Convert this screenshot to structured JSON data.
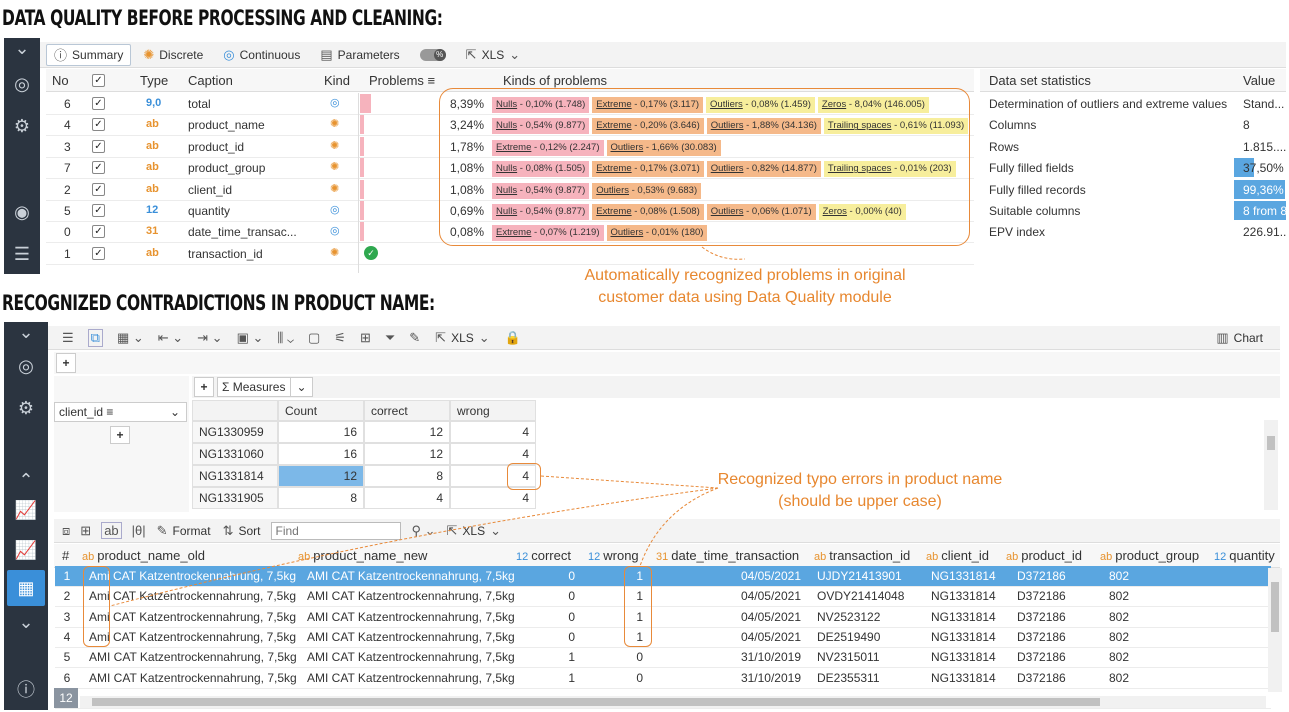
{
  "headings": {
    "top": "DATA QUALITY BEFORE PROCESSING AND CLEANING:",
    "bottom": "RECOGNIZED CONTRADICTIONS IN PRODUCT NAME:"
  },
  "dq_toolbar": {
    "summary": "Summary",
    "discrete": "Discrete",
    "continuous": "Continuous",
    "parameters": "Parameters",
    "xls": "XLS"
  },
  "dq_table": {
    "headers": {
      "no": "No",
      "type": "Type",
      "caption": "Caption",
      "kind": "Kind",
      "problems": "Problems",
      "kinds": "Kinds of problems"
    },
    "rows": [
      {
        "no": "6",
        "type": "9,0",
        "caption": "total",
        "kind": "continuous",
        "pct": "8,39%",
        "bar": 0.9,
        "tags": [
          {
            "c": "red",
            "name": "Nulls",
            "rest": " - 0,10% (1.748)"
          },
          {
            "c": "org",
            "name": "Extreme",
            "rest": " - 0,17% (3.117)"
          },
          {
            "c": "yel",
            "name": "Outliers",
            "rest": " - 0,08% (1.459)"
          },
          {
            "c": "yel",
            "name": "Zeros",
            "rest": " - 8,04% (146.005)"
          }
        ]
      },
      {
        "no": "4",
        "type": "ab",
        "caption": "product_name",
        "kind": "discrete",
        "pct": "3,24%",
        "bar": 0.35,
        "tags": [
          {
            "c": "red",
            "name": "Nulls",
            "rest": " - 0,54% (9.877)"
          },
          {
            "c": "org",
            "name": "Extreme",
            "rest": " - 0,20% (3.646)"
          },
          {
            "c": "org",
            "name": "Outliers",
            "rest": " - 1,88% (34.136)"
          },
          {
            "c": "yel",
            "name": "Trailing spaces",
            "rest": " - 0,61% (11.093)"
          }
        ]
      },
      {
        "no": "3",
        "type": "ab",
        "caption": "product_id",
        "kind": "discrete",
        "pct": "1,78%",
        "bar": 0.2,
        "tags": [
          {
            "c": "red",
            "name": "Extreme",
            "rest": " - 0,12% (2.247)"
          },
          {
            "c": "org",
            "name": "Outliers",
            "rest": " - 1,66% (30.083)"
          }
        ]
      },
      {
        "no": "7",
        "type": "ab",
        "caption": "product_group",
        "kind": "discrete",
        "pct": "1,08%",
        "bar": 0.12,
        "tags": [
          {
            "c": "red",
            "name": "Nulls",
            "rest": " - 0,08% (1.505)"
          },
          {
            "c": "org",
            "name": "Extreme",
            "rest": " - 0,17% (3.071)"
          },
          {
            "c": "org",
            "name": "Outliers",
            "rest": " - 0,82% (14.877)"
          },
          {
            "c": "yel",
            "name": "Trailing spaces",
            "rest": " - 0,01% (203)"
          }
        ]
      },
      {
        "no": "2",
        "type": "ab",
        "caption": "client_id",
        "kind": "discrete",
        "pct": "1,08%",
        "bar": 0.12,
        "tags": [
          {
            "c": "red",
            "name": "Nulls",
            "rest": " - 0,54% (9.877)"
          },
          {
            "c": "org",
            "name": "Outliers",
            "rest": " - 0,53% (9.683)"
          }
        ]
      },
      {
        "no": "5",
        "type": "12",
        "caption": "quantity",
        "kind": "continuous",
        "pct": "0,69%",
        "bar": 0.08,
        "tags": [
          {
            "c": "red",
            "name": "Nulls",
            "rest": " - 0,54% (9.877)"
          },
          {
            "c": "org",
            "name": "Extreme",
            "rest": " - 0,08% (1.508)"
          },
          {
            "c": "org",
            "name": "Outliers",
            "rest": " - 0,06% (1.071)"
          },
          {
            "c": "yel",
            "name": "Zeros",
            "rest": " - 0,00% (40)"
          }
        ]
      },
      {
        "no": "0",
        "type": "31",
        "caption": "date_time_transac...",
        "kind": "continuous",
        "pct": "0,08%",
        "bar": 0.02,
        "tags": [
          {
            "c": "red",
            "name": "Extreme",
            "rest": " - 0,07% (1.219)"
          },
          {
            "c": "org",
            "name": "Outliers",
            "rest": " - 0,01% (180)"
          }
        ]
      },
      {
        "no": "1",
        "type": "ab",
        "caption": "transaction_id",
        "kind": "discrete",
        "pct": "",
        "bar": 0,
        "ok": true,
        "tags": []
      }
    ]
  },
  "stats": {
    "headers": {
      "name": "Data set statistics",
      "value": "Value"
    },
    "rows": [
      {
        "name": "Determination of outliers and extreme values",
        "value": "Stand...",
        "bar": 0
      },
      {
        "name": "Columns",
        "value": "8",
        "bar": 0
      },
      {
        "name": "Rows",
        "value": "1.815....",
        "bar": 0
      },
      {
        "name": "Fully filled fields",
        "value": "37,50%",
        "bar": 0.375
      },
      {
        "name": "Fully filled records",
        "value": "99,36%",
        "bar": 0.99
      },
      {
        "name": "Suitable columns",
        "value": "8 from 8",
        "bar": 1
      },
      {
        "name": "EPV index",
        "value": "226.91...",
        "bar": 0
      }
    ]
  },
  "annotations": {
    "top": "Automatically recognized problems in original customer data using Data Quality module",
    "bottom": "Recognized typo errors in product name (should be upper case)"
  },
  "pivot_toolbar": {
    "xls": "XLS",
    "chart": "Chart"
  },
  "pivot": {
    "measures": "Measures",
    "field": "client_id",
    "headers": [
      "Count",
      "correct",
      "wrong"
    ],
    "rows": [
      {
        "id": "NG1330959",
        "count": "16",
        "correct": "12",
        "wrong": "4"
      },
      {
        "id": "NG1331060",
        "count": "16",
        "correct": "12",
        "wrong": "4"
      },
      {
        "id": "NG1331814",
        "count": "12",
        "correct": "8",
        "wrong": "4"
      },
      {
        "id": "NG1331905",
        "count": "8",
        "correct": "4",
        "wrong": "4"
      }
    ]
  },
  "data_toolbar": {
    "format": "Format",
    "sort": "Sort",
    "search_placeholder": "Find",
    "xls": "XLS"
  },
  "data_table": {
    "headers": [
      "#",
      "product_name_old",
      "product_name_new",
      "correct",
      "wrong",
      "date_time_transaction",
      "transaction_id",
      "client_id",
      "product_id",
      "product_group",
      "quantity"
    ],
    "rows": [
      [
        "1",
        "Ami CAT Katzentrockennahrung, 7,5kg",
        "AMI CAT Katzentrockennahrung, 7,5kg",
        "0",
        "1",
        "04/05/2021",
        "UJDY21413901",
        "NG1331814",
        "D372186",
        "802"
      ],
      [
        "2",
        "Ami CAT Katzentrockennahrung, 7,5kg",
        "AMI CAT Katzentrockennahrung, 7,5kg",
        "0",
        "1",
        "04/05/2021",
        "OVDY21414048",
        "NG1331814",
        "D372186",
        "802"
      ],
      [
        "3",
        "Ami CAT Katzentrockennahrung, 7,5kg",
        "AMI CAT Katzentrockennahrung, 7,5kg",
        "0",
        "1",
        "04/05/2021",
        "NV2523122",
        "NG1331814",
        "D372186",
        "802"
      ],
      [
        "4",
        "Ami CAT Katzentrockennahrung, 7,5kg",
        "AMI CAT Katzentrockennahrung, 7,5kg",
        "0",
        "1",
        "04/05/2021",
        "DE2519490",
        "NG1331814",
        "D372186",
        "802"
      ],
      [
        "5",
        "AMI CAT Katzentrockennahrung, 7,5kg",
        "AMI CAT Katzentrockennahrung, 7,5kg",
        "1",
        "0",
        "31/10/2019",
        "NV2315011",
        "NG1331814",
        "D372186",
        "802"
      ],
      [
        "6",
        "AMI CAT Katzentrockennahrung, 7,5kg",
        "AMI CAT Katzentrockennahrung, 7,5kg",
        "1",
        "0",
        "31/10/2019",
        "DE2355311",
        "NG1331814",
        "D372186",
        "802"
      ],
      [
        "12",
        "",
        "",
        "",
        "",
        "",
        "",
        "",
        "",
        ""
      ]
    ]
  }
}
